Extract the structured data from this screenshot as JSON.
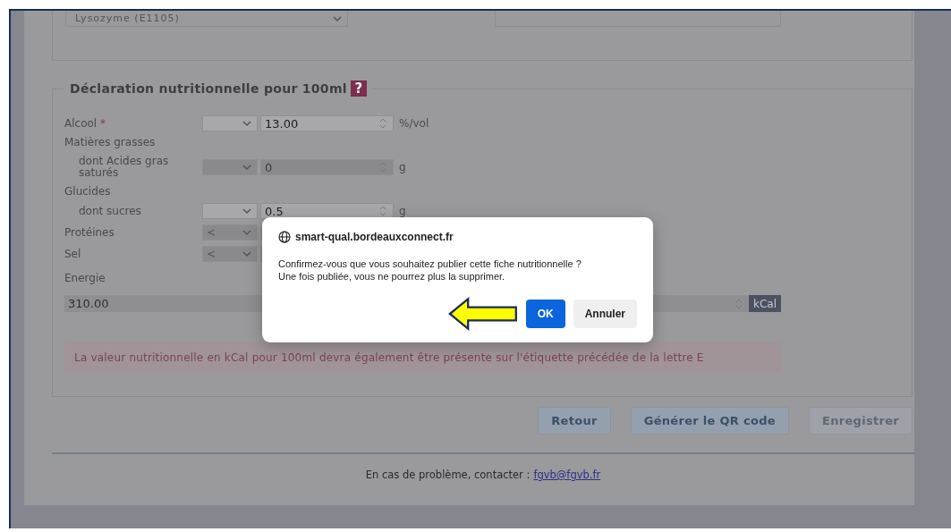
{
  "top_section": {
    "select_value": "Lysozyme (E1105)"
  },
  "nutrition": {
    "title": "Déclaration nutritionnelle pour 100ml",
    "help": "?",
    "rows": [
      {
        "kind": "field",
        "label": "Alcool",
        "required_mark": "*",
        "operator": "",
        "value": "13.00",
        "unit": "%/vol",
        "disabled": false
      },
      {
        "kind": "heading",
        "label": "Matières grasses"
      },
      {
        "kind": "subfield",
        "label": "dont Acides gras saturés",
        "operator": "",
        "value": "0",
        "unit": "g",
        "disabled": true
      },
      {
        "kind": "heading",
        "label": "Glucides"
      },
      {
        "kind": "subfield",
        "label": "dont sucres",
        "operator": "",
        "value": "0.5",
        "unit": "g",
        "disabled": false
      },
      {
        "kind": "field",
        "label": "Protéines",
        "operator": "<",
        "value": "",
        "unit": "",
        "disabled": true
      },
      {
        "kind": "field",
        "label": "Sel",
        "operator": "<",
        "value": "",
        "unit": "",
        "disabled": true
      }
    ],
    "energy": {
      "label": "Energie",
      "value": "310.00",
      "unit": "kCal"
    },
    "notice": "La valeur nutritionnelle en kCal pour 100ml devra également être présente sur l'étiquette précédée de la lettre E"
  },
  "actions": [
    {
      "label": "Retour",
      "disabled": false
    },
    {
      "label": "Générer le QR code",
      "disabled": false
    },
    {
      "label": "Enregistrer",
      "disabled": true
    }
  ],
  "footer": {
    "text": "En cas de problème, contacter :",
    "link": "fgvb@fgvb.fr"
  },
  "dialog": {
    "origin": "smart-qual.bordeauxconnect.fr",
    "message": [
      "Confirmez-vous que vous souhaitez publier cette fiche nutritionnelle ?",
      "Une fois publiée, vous ne pourrez plus la supprimer."
    ],
    "buttons": [
      {
        "label": "OK",
        "primary": true
      },
      {
        "label": "Annuler",
        "primary": false
      }
    ]
  }
}
